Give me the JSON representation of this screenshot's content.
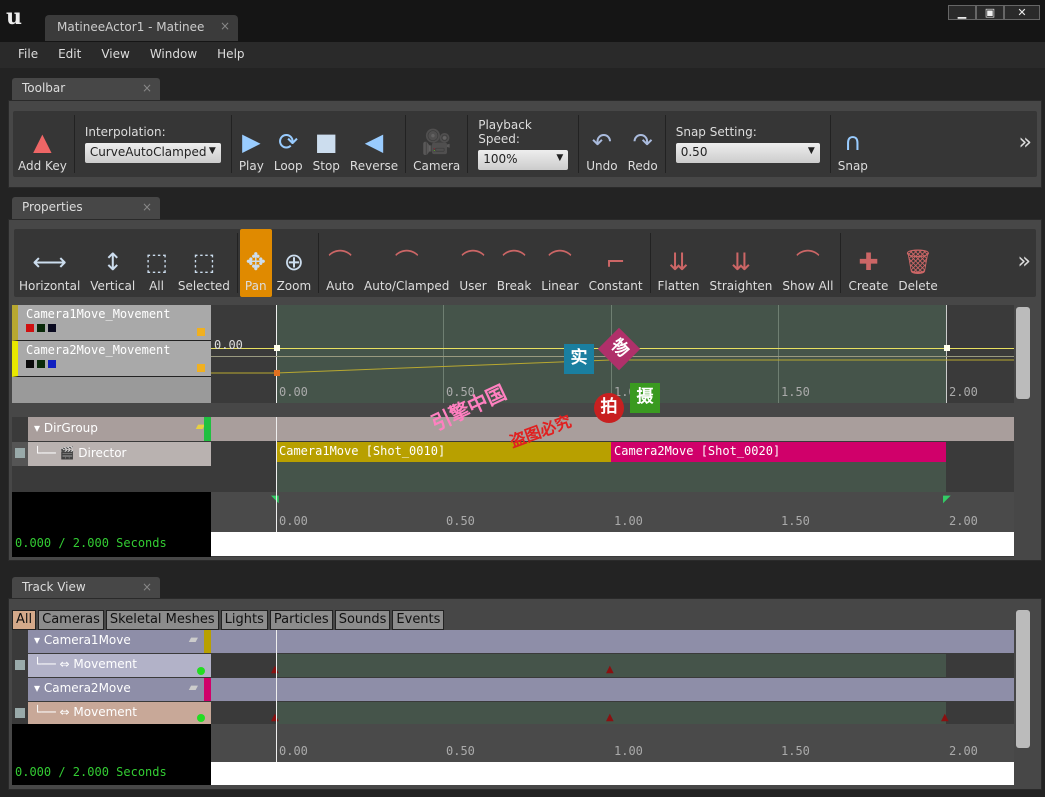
{
  "window": {
    "title": "MatineeActor1 - Matinee",
    "controls": [
      "minimize",
      "maximize",
      "close"
    ]
  },
  "menu": [
    "File",
    "Edit",
    "View",
    "Window",
    "Help"
  ],
  "toolbar": {
    "tab": "Toolbar",
    "add_key": "Add Key",
    "interpolation_label": "Interpolation:",
    "interpolation_value": "CurveAutoClamped",
    "play": "Play",
    "loop": "Loop",
    "stop": "Stop",
    "reverse": "Reverse",
    "camera": "Camera",
    "playback_label": "Playback Speed:",
    "playback_value": "100%",
    "undo": "Undo",
    "redo": "Redo",
    "snap_label": "Snap Setting:",
    "snap_value": "0.50",
    "snap": "Snap",
    "more": "»"
  },
  "properties": {
    "tab": "Properties",
    "buttons": [
      "Horizontal",
      "Vertical",
      "All",
      "Selected",
      "Pan",
      "Zoom",
      "Auto",
      "Auto/Clamped",
      "User",
      "Break",
      "Linear",
      "Constant",
      "Flatten",
      "Straighten",
      "Show All",
      "Create",
      "Delete"
    ],
    "active": "Pan",
    "more": "»"
  },
  "curves": {
    "tracks": [
      {
        "name": "Camera1Move_Movement",
        "color": "#b8a830",
        "swatches": [
          "#d01010",
          "#0a2a0a",
          "#0a0a20"
        ]
      },
      {
        "name": "Camera2Move_Movement",
        "color": "#e8e800",
        "swatches": [
          "#0a0a0a",
          "#0a2a0a",
          "#1020c0"
        ]
      }
    ],
    "value_label": "0.00",
    "ticks": [
      "0.00",
      "0.50",
      "1.00",
      "1.50",
      "2.00"
    ]
  },
  "director": {
    "group": "DirGroup",
    "track": "Director",
    "shots": [
      {
        "label": "Camera1Move [Shot_0010]",
        "start": 0,
        "end": 1.0,
        "color": "#b8a000"
      },
      {
        "label": "Camera2Move [Shot_0020]",
        "start": 1.0,
        "end": 2.0,
        "color": "#d0006a"
      }
    ],
    "time": "0.000 / 2.000 Seconds",
    "ticks": [
      "0.00",
      "0.50",
      "1.00",
      "1.50",
      "2.00"
    ]
  },
  "trackview": {
    "tab": "Track View",
    "filters": [
      "All",
      "Cameras",
      "Skeletal Meshes",
      "Lights",
      "Particles",
      "Sounds",
      "Events"
    ],
    "active_filter": "All",
    "groups": [
      {
        "name": "Camera1Move",
        "color": "#b8a000",
        "track": "Movement",
        "keys": [
          0,
          1.0
        ]
      },
      {
        "name": "Camera2Move",
        "color": "#d0006a",
        "track": "Movement",
        "keys": [
          0,
          1.0,
          2.0
        ]
      }
    ],
    "time": "0.000 / 2.000 Seconds",
    "ticks": [
      "0.00",
      "0.50",
      "1.00",
      "1.50",
      "2.00"
    ]
  },
  "watermark": {
    "a": "实",
    "b": "物",
    "c": "拍",
    "d": "摄",
    "e": "引擎中国",
    "f": "盗图必究"
  }
}
